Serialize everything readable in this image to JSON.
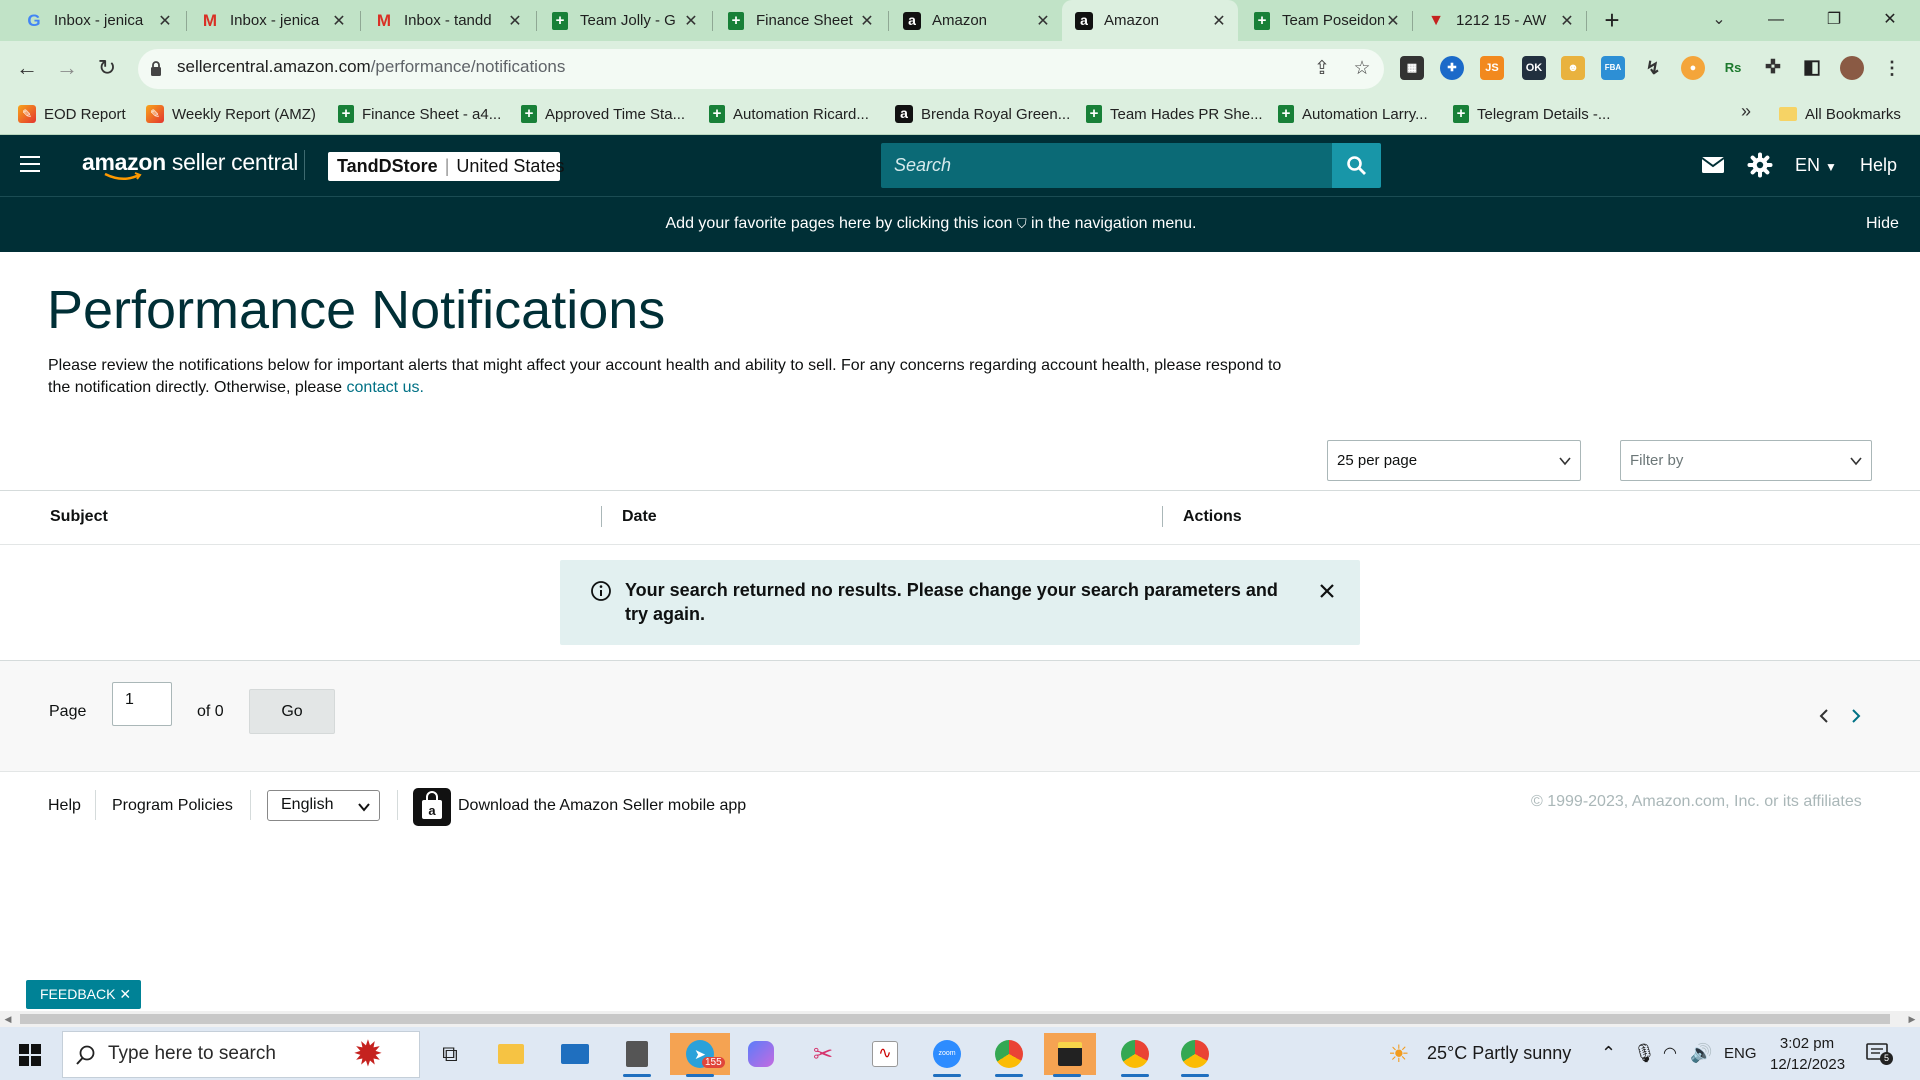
{
  "browser": {
    "tabs": [
      {
        "title": "Inbox - jenica",
        "favicon": "google-g-icon"
      },
      {
        "title": "Inbox - jenica",
        "favicon": "gmail-icon"
      },
      {
        "title": "Inbox - tandd",
        "favicon": "gmail-icon"
      },
      {
        "title": "Team Jolly - G",
        "favicon": "sheets-icon"
      },
      {
        "title": "Finance Sheet",
        "favicon": "sheets-icon"
      },
      {
        "title": "Amazon",
        "favicon": "amazon-icon"
      },
      {
        "title": "Amazon",
        "favicon": "amazon-icon",
        "active": true
      },
      {
        "title": "Team Poseidon",
        "favicon": "sheets-icon"
      },
      {
        "title": "1212 15 - AW",
        "favicon": "vivaldi-icon"
      }
    ],
    "url_host": "sellercentral.amazon.com",
    "url_path": "/performance/notifications",
    "bookmarks": [
      {
        "label": "EOD Report",
        "icon": "eod-icon"
      },
      {
        "label": "Weekly Report (AMZ)",
        "icon": "eod-icon"
      },
      {
        "label": "Finance Sheet - a4...",
        "icon": "sheets-icon"
      },
      {
        "label": "Approved Time Sta...",
        "icon": "sheets-icon"
      },
      {
        "label": "Automation Ricard...",
        "icon": "sheets-icon"
      },
      {
        "label": "Brenda Royal Green...",
        "icon": "amazon-icon"
      },
      {
        "label": "Team Hades PR She...",
        "icon": "sheets-icon"
      },
      {
        "label": "Automation Larry...",
        "icon": "sheets-icon"
      },
      {
        "label": "Telegram Details -...",
        "icon": "sheets-icon"
      }
    ],
    "all_bookmarks": "All Bookmarks",
    "more_bookmarks": "»",
    "ext_labels": {
      "js": "JS",
      "ok": "OK",
      "fba": "FBA",
      "rs": "Rs"
    }
  },
  "header": {
    "logo_bold": "amazon",
    "logo_rest": " seller central",
    "store_name": "TandDStore",
    "store_sep": "|",
    "store_region": "United States",
    "search_placeholder": "Search",
    "language": "EN",
    "help": "Help"
  },
  "favorites_banner": {
    "text_before": "Add your favorite pages here by clicking this icon",
    "text_after": "in the navigation menu.",
    "hide": "Hide"
  },
  "page": {
    "title": "Performance Notifications",
    "intro": "Please review the notifications below for important alerts that might affect your account health and ability to sell. For any concerns regarding account health, please respond to the notification directly. Otherwise, please",
    "contact_link": "contact us.",
    "per_page": "25 per page",
    "filter_placeholder": "Filter by",
    "columns": [
      "Subject",
      "Date",
      "Actions"
    ],
    "alert": "Your search returned no results. Please change your search parameters and try again.",
    "pager": {
      "label": "Page",
      "current": "1",
      "of": "of 0",
      "go": "Go"
    }
  },
  "footer": {
    "help": "Help",
    "policies": "Program Policies",
    "language": "English",
    "app_text": "Download the Amazon Seller mobile app",
    "copyright": "© 1999-2023, Amazon.com, Inc. or its affiliates",
    "feedback": "FEEDBACK ✕"
  },
  "taskbar": {
    "search_placeholder": "Type here to search",
    "telegram_badge": "155",
    "weather": "25°C  Partly sunny",
    "lang": "ENG",
    "time": "3:02 pm",
    "date": "12/12/2023",
    "notif_count": "5"
  },
  "colors": {
    "header_bg": "#002f36",
    "search_bg": "#0b6a76",
    "search_button": "#1896a8",
    "link": "#007185",
    "alert_bg": "#e2f0f0",
    "feedback_bg": "#008296",
    "tabstrip_bg": "#c1e3c7"
  }
}
